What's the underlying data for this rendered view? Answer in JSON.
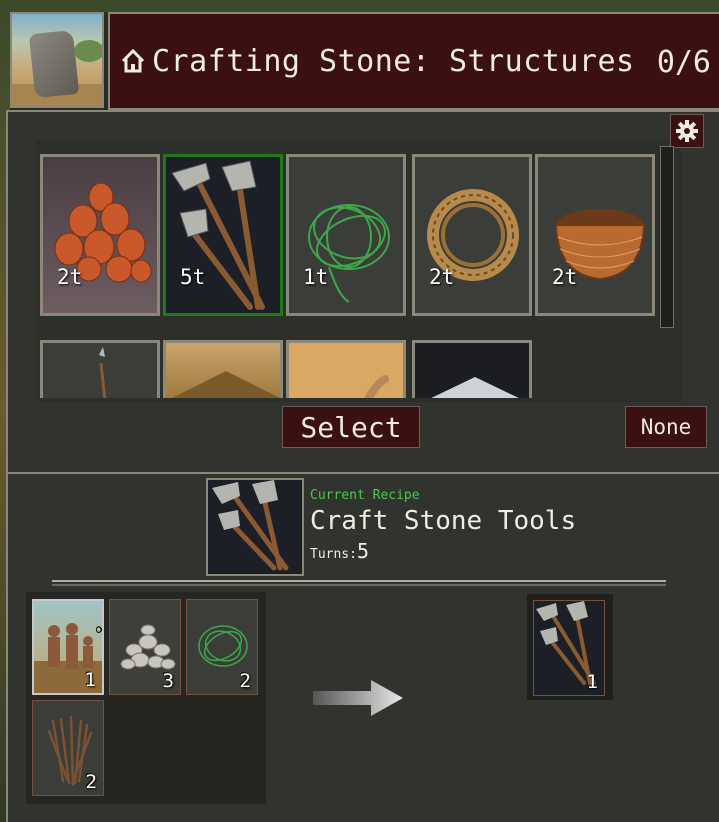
{
  "header": {
    "title": "Crafting Stone: Structures",
    "count": "0/6",
    "home_icon": "home-icon"
  },
  "settings": {
    "icon": "gear-icon"
  },
  "recipes": [
    {
      "name": "pottery",
      "turns": "2t",
      "selected": false
    },
    {
      "name": "stone-tools",
      "turns": "5t",
      "selected": true
    },
    {
      "name": "cordage",
      "turns": "1t",
      "selected": false
    },
    {
      "name": "rope",
      "turns": "2t",
      "selected": false
    },
    {
      "name": "basket",
      "turns": "2t",
      "selected": false
    }
  ],
  "recipes_row2": [
    "spears",
    "thatch-hut",
    "sand-clearing",
    "dark-tent"
  ],
  "buttons": {
    "select": "Select",
    "none": "None"
  },
  "current_recipe": {
    "label": "Current Recipe",
    "name": "Craft Stone Tools",
    "turns_label": "Turns:",
    "turns_value": "5"
  },
  "inputs": [
    {
      "item": "workers",
      "qty": "1",
      "badge": "infinity-icon"
    },
    {
      "item": "stones",
      "qty": "3"
    },
    {
      "item": "cordage",
      "qty": "2"
    },
    {
      "item": "sticks",
      "qty": "2"
    }
  ],
  "output": {
    "item": "stone-tools",
    "qty": "1"
  },
  "colors": {
    "header_bg": "#3a1010",
    "panel_bg": "#30332e",
    "selected_border": "#1f7a1f",
    "recipe_label": "#4fc74f"
  }
}
